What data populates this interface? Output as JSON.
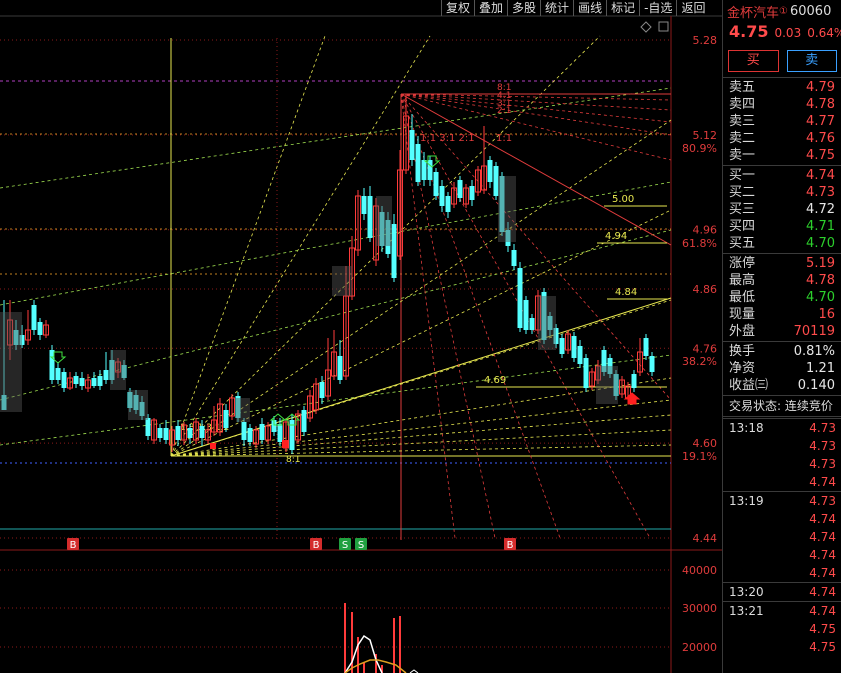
{
  "toolbar": {
    "buttons": [
      "复权",
      "叠加",
      "多股",
      "统计",
      "画线",
      "标记",
      "-自选",
      "返回"
    ]
  },
  "stock": {
    "name": "金杯汽车",
    "superscript": "①",
    "code": "60060"
  },
  "quote": {
    "price": "4.75",
    "change": "0.03",
    "change_pct": "0.64%"
  },
  "actions": {
    "buy": "买",
    "sell": "卖"
  },
  "asks": [
    {
      "label": "卖五",
      "price": "4.79"
    },
    {
      "label": "卖四",
      "price": "4.78"
    },
    {
      "label": "卖三",
      "price": "4.77"
    },
    {
      "label": "卖二",
      "price": "4.76"
    },
    {
      "label": "卖一",
      "price": "4.75"
    }
  ],
  "bids": [
    {
      "label": "买一",
      "price": "4.74",
      "color": "#ff4b4b"
    },
    {
      "label": "买二",
      "price": "4.73",
      "color": "#ff4b4b"
    },
    {
      "label": "买三",
      "price": "4.72",
      "color": "#e6e6e6"
    },
    {
      "label": "买四",
      "price": "4.71",
      "color": "#2ccf2c"
    },
    {
      "label": "买五",
      "price": "4.70",
      "color": "#2ccf2c"
    }
  ],
  "stats1": [
    {
      "label": "涨停",
      "value": "5.19",
      "color": "#ff4b4b"
    },
    {
      "label": "最高",
      "value": "4.78",
      "color": "#ff4b4b"
    },
    {
      "label": "最低",
      "value": "4.70",
      "color": "#2ccf2c"
    },
    {
      "label": "现量",
      "value": "16",
      "color": "#ff4b4b"
    },
    {
      "label": "外盘",
      "value": "70119",
      "color": "#ff4b4b"
    }
  ],
  "stats2": [
    {
      "label": "换手",
      "value": "0.81%"
    },
    {
      "label": "净资",
      "value": "1.21"
    },
    {
      "label": "收益㈢",
      "value": "0.140"
    }
  ],
  "trade_status": {
    "label": "交易状态:",
    "value": "连续竞价"
  },
  "ticks": [
    {
      "time": "13:18",
      "price": "4.73"
    },
    {
      "time": "",
      "price": "4.73"
    },
    {
      "time": "",
      "price": "4.73"
    },
    {
      "time": "",
      "price": "4.74"
    },
    {
      "time": "13:19",
      "price": "4.73"
    },
    {
      "time": "",
      "price": "4.74"
    },
    {
      "time": "",
      "price": "4.74"
    },
    {
      "time": "",
      "price": "4.74"
    },
    {
      "time": "",
      "price": "4.74"
    },
    {
      "time": "13:20",
      "price": "4.74"
    },
    {
      "time": "13:21",
      "price": "4.74"
    },
    {
      "time": "",
      "price": "4.75"
    },
    {
      "time": "",
      "price": "4.75"
    }
  ],
  "price_axis": {
    "ticks": [
      "5.28",
      "5.12",
      "4.96",
      "4.86",
      "4.76",
      "4.60",
      "4.44"
    ],
    "fib_labels": [
      "80.9%",
      "61.8%",
      "38.2%",
      "19.1%"
    ],
    "tick_color": "#e03c3c"
  },
  "volume_axis": {
    "ticks": [
      "40000",
      "30000",
      "20000"
    ]
  },
  "chart_annotations": {
    "levels": [
      "5.00",
      "4.94",
      "4.84",
      "4.69"
    ],
    "fib_top": [
      "8:1",
      "4:1",
      "3:1",
      "2:1"
    ],
    "fib_mid": "1:1",
    "fib_bottom": "8:1",
    "gann_mid": "1:1  3:1  2:1",
    "gann_low": "1:8 1:3 1:2",
    "signals": [
      "B",
      "B",
      "S",
      "S",
      "B"
    ]
  },
  "colors": {
    "up": "#ff3b3b",
    "down": "#54ffff",
    "fib": "#e8e850",
    "grid": "#8b1a1a"
  }
}
